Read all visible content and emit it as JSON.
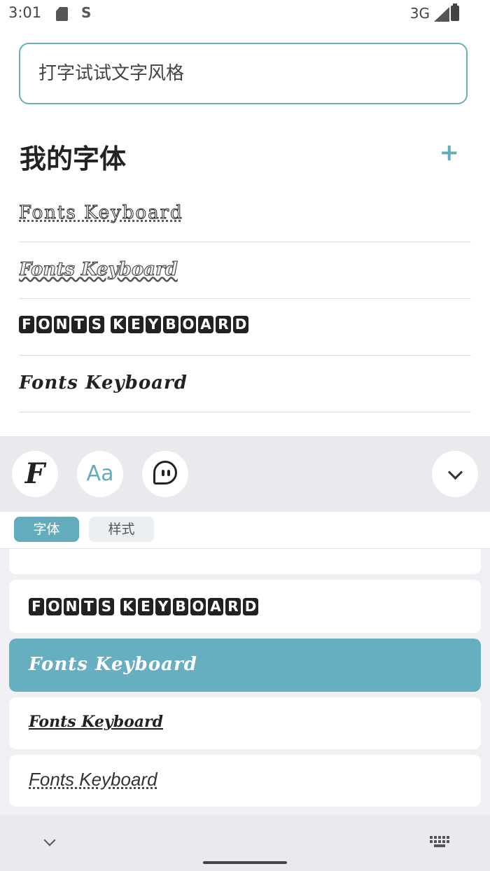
{
  "status_bar": {
    "time": "3:01",
    "network": "3G",
    "icons": [
      "sd-card-icon",
      "s-app-icon",
      "signal-icon",
      "battery-icon"
    ]
  },
  "input": {
    "placeholder": "打字试试文字风格"
  },
  "my_fonts": {
    "title": "我的字体",
    "items": [
      {
        "style": "outlined",
        "text": "Fonts Keyboard"
      },
      {
        "style": "script",
        "text": "Fonts Keyboard"
      },
      {
        "style": "boxed",
        "text": "FONTS KEYBOARD"
      },
      {
        "style": "gothic",
        "text": "Fonts Keyboard"
      }
    ]
  },
  "toolbar": {
    "f_label": "F",
    "aa_label": "Aa",
    "buttons": [
      "font-icon",
      "aa-icon",
      "emoji-icon",
      "chevron-down-icon"
    ]
  },
  "tabs": [
    {
      "label": "字体",
      "active": true
    },
    {
      "label": "样式",
      "active": false
    }
  ],
  "style_list": {
    "items": [
      {
        "style": "boxed",
        "text": "FONTS KEYBOARD",
        "selected": false
      },
      {
        "style": "gothic",
        "text": "Fonts Keyboard",
        "selected": true
      },
      {
        "style": "script-underline",
        "text": "Fonts Keyboard",
        "selected": false
      },
      {
        "style": "italic-arrows",
        "text": "Fonts Keyboard",
        "selected": false
      }
    ]
  },
  "colors": {
    "accent": "#64acbd",
    "selected_bg": "#67aec0",
    "toolbar_bg": "#e8eaed"
  }
}
